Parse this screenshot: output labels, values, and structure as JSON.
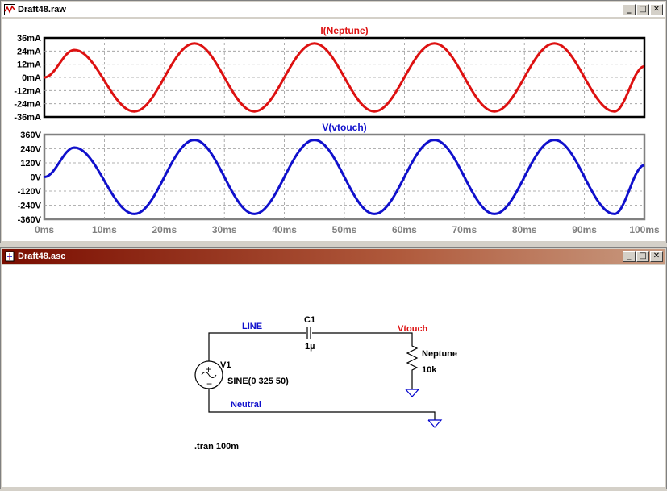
{
  "waveform_window": {
    "title": "Draft48.raw",
    "icon": "waveform-icon",
    "buttons": {
      "minimize": "_",
      "restore": "□",
      "close": "✕"
    }
  },
  "schematic_window": {
    "title": "Draft48.asc",
    "icon": "schematic-icon",
    "buttons": {
      "minimize": "_",
      "restore": "□",
      "close": "✕"
    }
  },
  "chart_data": [
    {
      "type": "line",
      "title": "I(Neptune)",
      "color": "#dd1111",
      "y_ticks": [
        "36mA",
        "24mA",
        "12mA",
        "0mA",
        "-12mA",
        "-24mA",
        "-36mA"
      ],
      "ylim": [
        -36,
        36
      ],
      "xlim": [
        0,
        100
      ],
      "series": [
        {
          "name": "I(Neptune)",
          "x": [
            0,
            5,
            15,
            25,
            35,
            45,
            55,
            65,
            75,
            85,
            95,
            100
          ],
          "y": [
            0,
            25,
            -31,
            31,
            -31,
            31,
            -31,
            31,
            -31,
            31,
            -31,
            10
          ]
        }
      ]
    },
    {
      "type": "line",
      "title": "V(vtouch)",
      "color": "#1010cc",
      "y_ticks": [
        "360V",
        "240V",
        "120V",
        "0V",
        "-120V",
        "-240V",
        "-360V"
      ],
      "ylim": [
        -360,
        360
      ],
      "xlim": [
        0,
        100
      ],
      "x_ticks": [
        "0ms",
        "10ms",
        "20ms",
        "30ms",
        "40ms",
        "50ms",
        "60ms",
        "70ms",
        "80ms",
        "90ms",
        "100ms"
      ],
      "series": [
        {
          "name": "V(vtouch)",
          "x": [
            0,
            5,
            15,
            25,
            35,
            45,
            55,
            65,
            75,
            85,
            95,
            100
          ],
          "y": [
            0,
            250,
            -315,
            315,
            -315,
            315,
            -315,
            315,
            -315,
            315,
            -315,
            100
          ]
        }
      ]
    }
  ],
  "schematic": {
    "net_line": "LINE",
    "net_vtouch": "Vtouch",
    "net_neutral": "Neutral",
    "cap_name": "C1",
    "cap_value": "1µ",
    "res_name": "Neptune",
    "res_value": "10k",
    "src_name": "V1",
    "src_value": "SINE(0 325 50)",
    "directive": ".tran 100m",
    "colors": {
      "net_label": "#1010cc",
      "vtouch_label": "#dd1111",
      "wire": "#000000",
      "symbol": "#0000cc"
    }
  }
}
